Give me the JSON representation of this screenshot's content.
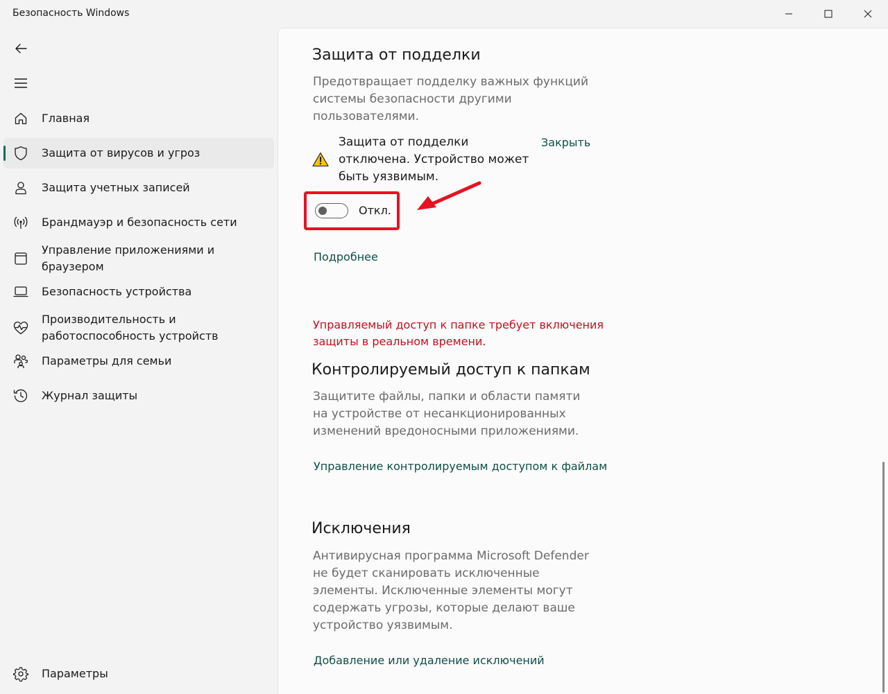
{
  "window": {
    "title": "Безопасность Windows"
  },
  "sidebar": {
    "items": [
      {
        "label": "Главная",
        "icon": "home-icon"
      },
      {
        "label": "Защита от вирусов и угроз",
        "icon": "shield-icon",
        "active": true
      },
      {
        "label": "Защита учетных записей",
        "icon": "person-icon"
      },
      {
        "label": "Брандмауэр и безопасность сети",
        "icon": "wifi-broadcast-icon"
      },
      {
        "label": "Управление приложениями и\nбраузером",
        "icon": "app-window-icon"
      },
      {
        "label": "Безопасность устройства",
        "icon": "laptop-icon"
      },
      {
        "label": "Производительность и\nработоспособность устройств",
        "icon": "heart-pulse-icon"
      },
      {
        "label": "Параметры для семьи",
        "icon": "family-icon"
      },
      {
        "label": "Журнал защиты",
        "icon": "history-icon"
      }
    ],
    "settings_label": "Параметры"
  },
  "tamper": {
    "title": "Защита от подделки",
    "description": "Предотвращает подделку важных функций системы безопасности другими пользователями.",
    "warning": "Защита от подделки отключена. Устройство может быть уязвимым.",
    "close_link": "Закрыть",
    "toggle_state": "Откл.",
    "toggle_on": false,
    "more_link": "Подробнее"
  },
  "cfa": {
    "error": "Управляемый доступ к папке требует включения защиты в реальном времени.",
    "title": "Контролируемый доступ к папкам",
    "description": "Защитите файлы, папки и области памяти на устройстве от несанкционированных изменений вредоносными приложениями.",
    "manage_link": "Управление контролируемым доступом к файлам"
  },
  "exclusions": {
    "title": "Исключения",
    "description": "Антивирусная программа Microsoft Defender не будет сканировать исключенные элементы. Исключенные элементы могут содержать угрозы, которые делают ваше устройство уязвимым.",
    "link": "Добавление или удаление исключений"
  },
  "colors": {
    "accent": "#0f6b5b",
    "link": "#0f4f47",
    "error": "#c50f1f",
    "highlight": "#e81123"
  }
}
